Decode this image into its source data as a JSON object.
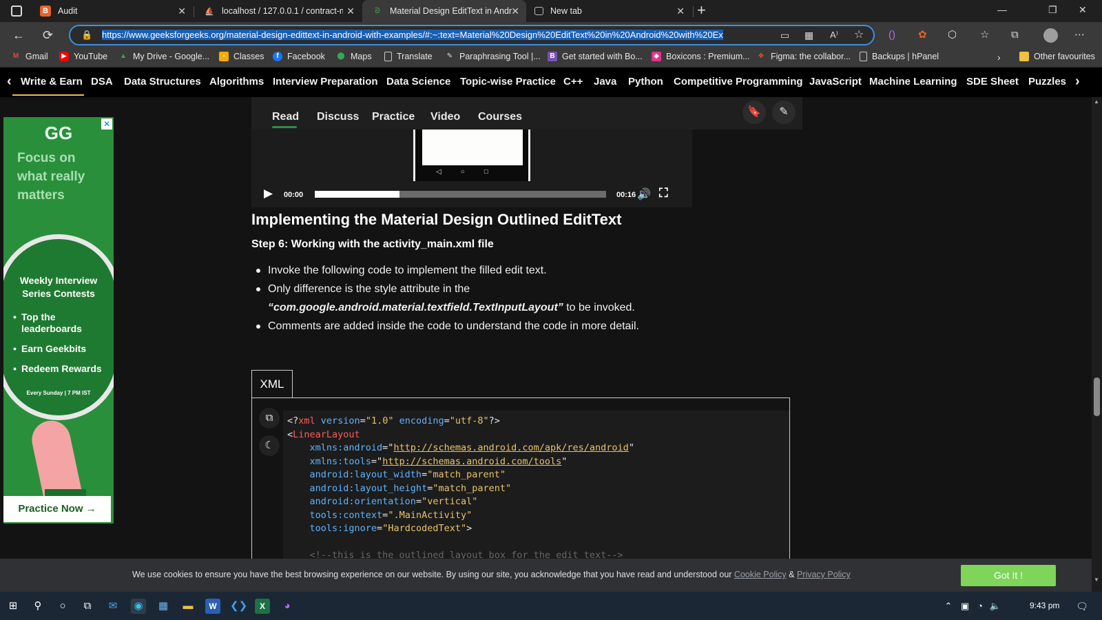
{
  "tabs": [
    {
      "title": "Audit",
      "favicon": "audit-icon",
      "active": false
    },
    {
      "title": "localhost / 127.0.0.1 / contract-m",
      "favicon": "phpmyadmin-icon",
      "active": false
    },
    {
      "title": "Material Design EditText in Andr",
      "favicon": "gfg-icon",
      "active": true
    },
    {
      "title": "New tab",
      "favicon": "newtab-icon",
      "active": false
    }
  ],
  "address_bar": {
    "url": "https://www.geeksforgeeks.org/material-design-edittext-in-android-with-examples/#:~:text=Material%20Design%20EditText%20in%20Android%20with%20Ex"
  },
  "bookmarks": [
    {
      "label": "Gmail",
      "color": "#ea4335"
    },
    {
      "label": "YouTube",
      "color": "#ff0000"
    },
    {
      "label": "My Drive - Google...",
      "color": "#34a853"
    },
    {
      "label": "Classes",
      "color": "#f9ab00"
    },
    {
      "label": "Facebook",
      "color": "#1877f2"
    },
    {
      "label": "Maps",
      "color": "#34a853"
    },
    {
      "label": "Translate",
      "color": "#8a8a8a"
    },
    {
      "label": "Paraphrasing Tool |...",
      "color": "#8a8a8a"
    },
    {
      "label": "Get started with Bo...",
      "color": "#7952b3"
    },
    {
      "label": "Boxicons : Premium...",
      "color": "#e0348f"
    },
    {
      "label": "Figma: the collabor...",
      "color": "#f24e1e"
    },
    {
      "label": "Backups | hPanel",
      "color": "#8a8a8a"
    }
  ],
  "other_favourites": "Other favourites",
  "gfg_nav": [
    "Write & Earn",
    "DSA",
    "Data Structures",
    "Algorithms",
    "Interview Preparation",
    "Data Science",
    "Topic-wise Practice",
    "C++",
    "Java",
    "Python",
    "Competitive Programming",
    "JavaScript",
    "Machine Learning",
    "SDE Sheet",
    "Puzzles"
  ],
  "ad": {
    "logo": "GG",
    "headline": "Focus on what really matters",
    "title": "Weekly Interview Series Contests",
    "points": [
      "Top the leaderboards",
      "Earn Geekbits",
      "Redeem Rewards"
    ],
    "schedule": "Every Sunday | 7 PM IST",
    "cta": "Practice Now →"
  },
  "article_tabs": [
    "Read",
    "Discuss",
    "Practice",
    "Video",
    "Courses"
  ],
  "video": {
    "current_time": "00:00",
    "duration": "00:16",
    "played_fraction": 0.0,
    "buffered_fraction": 0.29
  },
  "article": {
    "heading": "Implementing the Material Design Outlined EditText",
    "step": "Step 6: Working with the activity_main.xml file",
    "bullet1": "Invoke the following code to implement the filled edit text.",
    "bullet2_pre": "Only difference is the style attribute in the",
    "bullet2_em": "“com.google.android.material.textfield.TextInputLayout”",
    "bullet2_post": " to be invoked.",
    "bullet3": "Comments are added inside the code to understand the code in more detail."
  },
  "code": {
    "language": "XML",
    "l1_a": "<?",
    "l1_tag": "xml",
    "l1_attr1": " version",
    "l1_eq1": "=",
    "l1_v1": "\"1.0\"",
    "l1_attr2": " encoding",
    "l1_eq2": "=",
    "l1_v2": "\"utf-8\"",
    "l1_end": "?>",
    "l2_lt": "<",
    "l2_tag": "LinearLayout",
    "l3_attr": "    xmlns:android",
    "l3_v": "http://schemas.android.com/apk/res/android",
    "l4_attr": "    xmlns:tools",
    "l4_v": "http://schemas.android.com/tools",
    "l5_attr": "    android:layout_width",
    "l5_v": "\"match_parent\"",
    "l6_attr": "    android:layout_height",
    "l6_v": "\"match_parent\"",
    "l7_attr": "    android:orientation",
    "l7_v": "\"vertical\"",
    "l8_attr": "    tools:context",
    "l8_v": "\".MainActivity\"",
    "l9_attr": "    tools:ignore",
    "l9_v": "\"HardcodedText\"",
    "l9_end": ">",
    "l10": "    <!--this is the outlined layout box for the edit text-->"
  },
  "cookie": {
    "message": "We use cookies to ensure you have the best browsing experience on our website. By using our site, you acknowledge that you have read and understood our ",
    "cookie_policy": "Cookie Policy",
    "amp": " & ",
    "privacy_policy": "Privacy Policy",
    "button": "Got It !"
  },
  "clock": "9:43 pm"
}
